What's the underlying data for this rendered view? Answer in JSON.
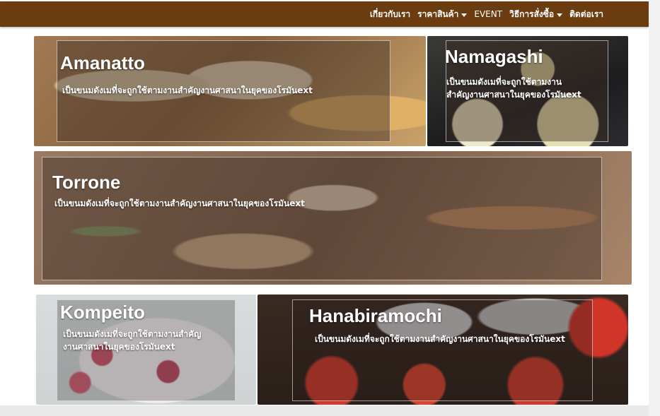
{
  "nav": {
    "items": [
      {
        "label": "เกี่ยวกับเรา",
        "dropdown": false
      },
      {
        "label": "ราคาสินค้า",
        "dropdown": true
      },
      {
        "label": "EVENT",
        "dropdown": false
      },
      {
        "label": "วิธีการสั่งซื้อ",
        "dropdown": true
      },
      {
        "label": "ติดต่อเรา",
        "dropdown": false
      }
    ],
    "bg_color": "#6a3c10"
  },
  "cards": [
    {
      "title": "Amanatto",
      "desc": "เป็นขนมดังเมที่จะถูกใช้ตามงานสำคัญงานศาสนาในยุคของโรมันext"
    },
    {
      "title": "Namagashi",
      "desc_line1": "เป็นขนมดังเมที่จะถูกใช้ตามงาน",
      "desc_line2": "สำคัญงานศาสนาในยุคของโรมันext"
    },
    {
      "title": "Torrone",
      "desc": "เป็นขนมดังเมที่จะถูกใช้ตามงานสำคัญงานศาสนาในยุคของโรมันext"
    },
    {
      "title": "Kompeito",
      "desc_line1": "เป็นขนมดังเมที่จะถูกใช้ตามงานสำคัญ",
      "desc_line2": "งานศาสนาในยุคของโรมันext"
    },
    {
      "title": "Hanabiramochi",
      "desc": "เป็นขนมดังเมที่จะถูกใช้ตามงานสำคัญงานศาสนาในยุคของโรมันext"
    }
  ]
}
